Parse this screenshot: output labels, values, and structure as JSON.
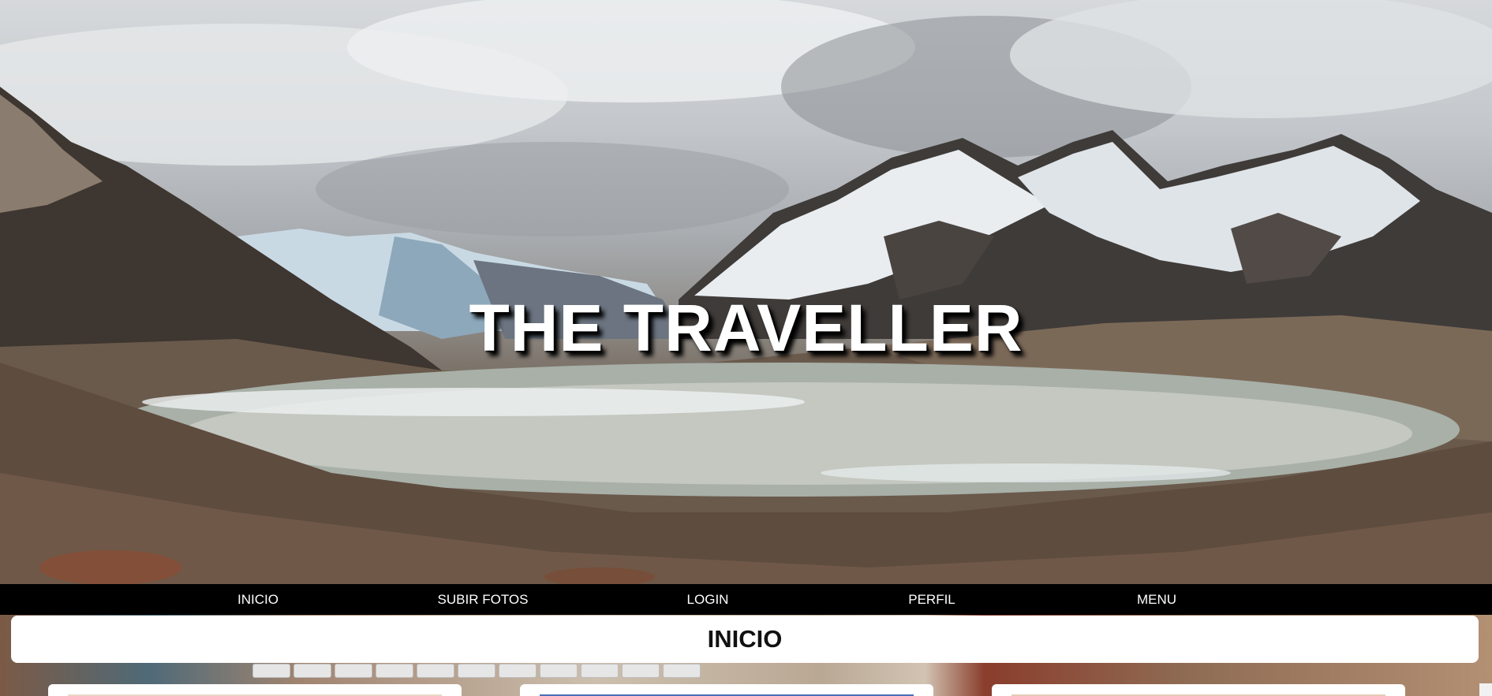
{
  "hero": {
    "title": "THE TRAVELLER",
    "image_icon": "mountain-lake-landscape"
  },
  "nav": {
    "items": [
      {
        "label": "INICIO"
      },
      {
        "label": "SUBIR FOTOS"
      },
      {
        "label": "LOGIN"
      },
      {
        "label": "PERFIL"
      },
      {
        "label": "MENU"
      }
    ]
  },
  "main": {
    "section_title": "INICIO"
  },
  "colors": {
    "nav_background": "#000000",
    "nav_text": "#ffffff",
    "title_text": "#ffffff",
    "panel_background": "#ffffff"
  }
}
